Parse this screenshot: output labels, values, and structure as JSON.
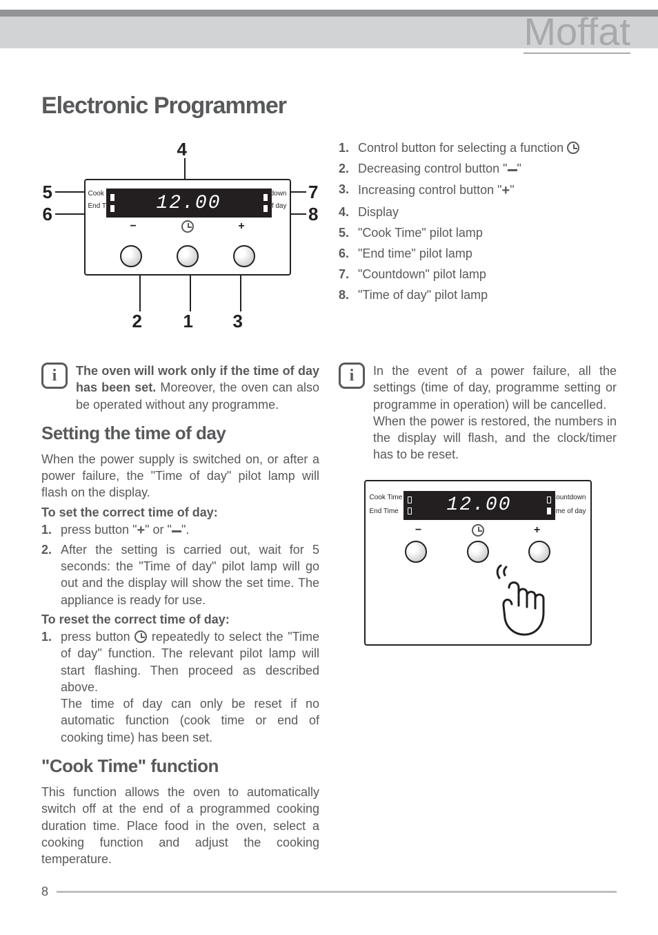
{
  "brand": "Moffat",
  "page_number": "8",
  "title": "Electronic Programmer",
  "diagram": {
    "callouts": {
      "c1": "1",
      "c2": "2",
      "c3": "3",
      "c4": "4",
      "c5": "5",
      "c6": "6",
      "c7": "7",
      "c8": "8"
    },
    "display_time": "12.00",
    "labels": {
      "cook_time": "Cook Time",
      "end_time": "End Time",
      "countdown": "Countdown",
      "time_of_day": "Time of day"
    },
    "symbols": {
      "minus": "−",
      "plus": "+"
    }
  },
  "legend": [
    {
      "num": "1.",
      "text": "Control button for selecting a function ",
      "clock": true
    },
    {
      "num": "2.",
      "text": "Decreasing control button \"",
      "minus": true,
      "tail": "\""
    },
    {
      "num": "3.",
      "text": "Increasing control button  \"",
      "plus": true,
      "tail": "\""
    },
    {
      "num": "4.",
      "text": "Display"
    },
    {
      "num": "5.",
      "text": "\"Cook Time\" pilot lamp"
    },
    {
      "num": "6.",
      "text": "\"End time\" pilot lamp"
    },
    {
      "num": "7.",
      "text": "\"Countdown\" pilot lamp"
    },
    {
      "num": "8.",
      "text": "\"Time of day\" pilot lamp"
    }
  ],
  "info1": {
    "bold": "The oven will work only if the time of day has been set.",
    "rest": " Moreover, the oven can also be operated without any programme."
  },
  "info2": "In the event of a power failure, all the settings (time of day, programme setting or programme in operation) will be cancelled.",
  "info2b": "When the power is restored, the numbers in the display will flash, and the clock/timer has to be reset.",
  "section_setting": {
    "heading": "Setting the time of day",
    "para": "When the power supply is switched on, or after a power failure, the \"Time of day\" pilot lamp  will flash on the display.",
    "set_heading": "To set the correct time of day:",
    "steps_set": [
      {
        "num": "1.",
        "pre": "press button \"",
        "plus": true,
        "mid": "\" or \"",
        "minus": true,
        "post": "\"."
      },
      {
        "num": "2.",
        "text": "After the setting is carried out, wait for 5 seconds: the \"Time of day\" pilot lamp will go out and the display will show the set time. The appliance is ready for use."
      }
    ],
    "reset_heading": "To reset the correct time of day:",
    "steps_reset": [
      {
        "num": "1.",
        "pre": "press button ",
        "clock": true,
        "post": " repeatedly to select the \"Time of day\" function. The relevant pilot lamp will start flashing. Then proceed as described above."
      }
    ],
    "reset_note": "The time of day can only be reset  if no automatic function (cook time or end of cooking time) has been set."
  },
  "section_cooktime": {
    "heading": "\"Cook Time\" function",
    "para": "This function allows the oven to automatically switch off at the end of a programmed cooking duration time. Place  food in the oven, select a cooking function and adjust the cooking temperature."
  },
  "diagram2": {
    "display_time": "12.00",
    "labels": {
      "cook_time": "Cook Time",
      "end_time": "End Time",
      "countdown": "Countdown",
      "time_of_day": "Time of day"
    }
  }
}
